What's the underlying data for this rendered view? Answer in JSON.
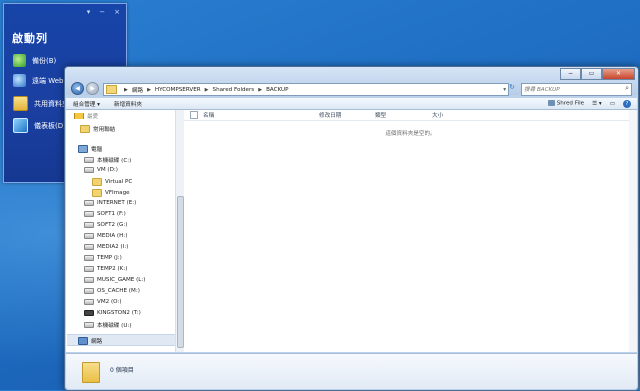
{
  "start_panel": {
    "controls": [
      "▾",
      "−",
      "×"
    ],
    "title": "啟動列",
    "items": [
      {
        "label": "備份(B)",
        "icon": "backup-icon"
      },
      {
        "label": "遠端 Web",
        "icon": "remote-web-icon"
      },
      {
        "label": "共用資料夾",
        "icon": "shared-folders-icon"
      },
      {
        "label": "儀表板(D)",
        "icon": "dashboard-icon"
      }
    ]
  },
  "explorer": {
    "window_buttons": [
      "−",
      "▭",
      "✕"
    ],
    "breadcrumb": [
      "網路",
      "HYCOMPSERVER",
      "Shared Folders",
      "BACKUP"
    ],
    "search_placeholder": "搜尋 BACKUP",
    "toolbar": {
      "organize": "組合管理 ▾",
      "new_folder": "新增資料夾",
      "shared_file": "Shred File"
    },
    "nav": {
      "favorites": "最愛",
      "favorites_sub": "常用聯結",
      "computer": "電腦",
      "tree": [
        {
          "label": "本機磁碟 (C:)",
          "type": "drive"
        },
        {
          "label": "VM (D:)",
          "type": "drive"
        },
        {
          "label": "Virtual PC",
          "type": "folder"
        },
        {
          "label": "VFImage",
          "type": "folder"
        },
        {
          "label": "INTERNET (E:)",
          "type": "drive"
        },
        {
          "label": "SOFT1 (F:)",
          "type": "drive"
        },
        {
          "label": "SOFT2 (G:)",
          "type": "drive"
        },
        {
          "label": "MEDIA (H:)",
          "type": "drive"
        },
        {
          "label": "MEDIA2 (I:)",
          "type": "drive"
        },
        {
          "label": "TEMP (J:)",
          "type": "drive"
        },
        {
          "label": "TEMP2 (K:)",
          "type": "drive"
        },
        {
          "label": "MUSIC_GAME (L:)",
          "type": "drive"
        },
        {
          "label": "OS_CACHE (M:)",
          "type": "drive"
        },
        {
          "label": "VM2 (O:)",
          "type": "drive"
        },
        {
          "label": "KINGSTON2 (T:)",
          "type": "usb"
        },
        {
          "label": "本機磁碟 (U:)",
          "type": "drive"
        }
      ],
      "network": "網路"
    },
    "columns": [
      "名稱",
      "修改日期",
      "類型",
      "大小"
    ],
    "empty_message": "這個資料夾是空的。",
    "status": "0 個項目"
  }
}
